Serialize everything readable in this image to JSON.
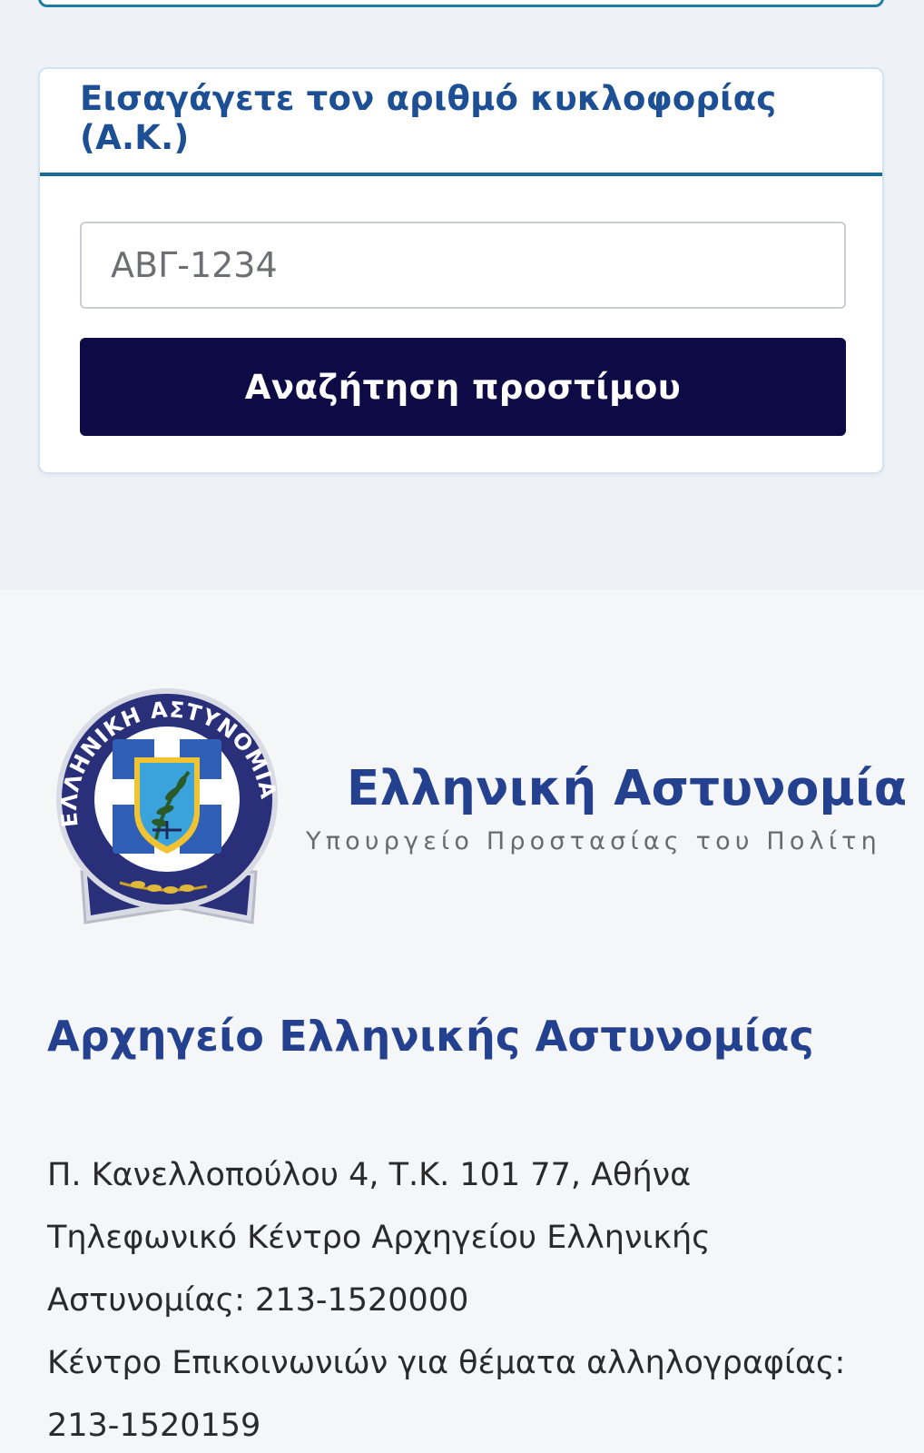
{
  "search_form": {
    "title": "Εισαγάγετε τον αριθμό κυκλοφορίας (Α.Κ.)",
    "plate_placeholder": "ΑΒΓ-1234",
    "plate_value": "",
    "button_label": "Αναζήτηση προστίμου"
  },
  "footer": {
    "emblem": {
      "ring_text": "ΕΛΛΗΝΙΚΗ ΑΣΤΥΝΟΜΙΑ",
      "icon": "hellenic-police-emblem"
    },
    "brand_name": "Ελληνική Αστυνομία",
    "brand_subtitle": "Υπουργείο Προστασίας του Πολίτη",
    "hq_title": "Αρχηγείο Ελληνικής Αστυνομίας",
    "contact_lines": [
      "Π. Κανελλοπούλου 4, Τ.Κ. 101 77, Αθήνα",
      "Τηλεφωνικό Κέντρο Αρχηγείου Ελληνικής",
      "Αστυνομίας: 213-1520000",
      "Κέντρο Επικοινωνιών για θέματα αλληλογραφίας:",
      "213-1520159"
    ]
  },
  "colors": {
    "primary_blue": "#1d4f95",
    "button_navy": "#0d0a45",
    "divider_teal": "#1a6d92",
    "page_background": "#eef1f6",
    "footer_background": "#f5f6f8"
  }
}
